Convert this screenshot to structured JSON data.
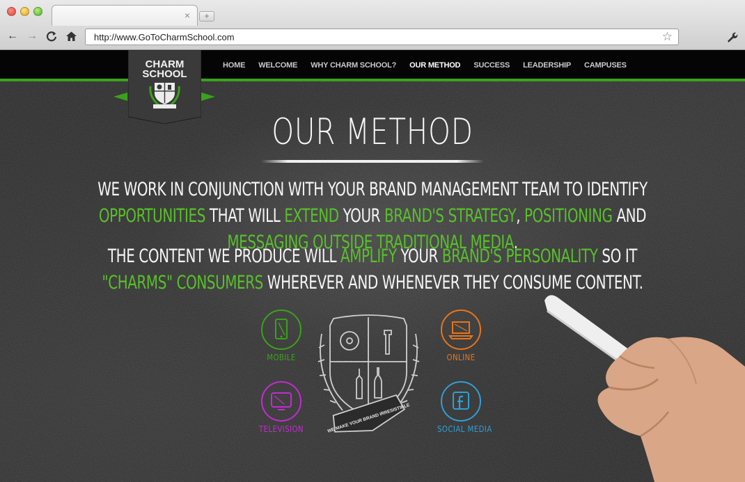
{
  "browser": {
    "tab_close": "×",
    "new_tab": "+",
    "back": "←",
    "forward": "→",
    "reload": "C",
    "home": "⌂",
    "url": "http://www.GoToCharmSchool.com",
    "bookmark": "☆",
    "settings": "🔧"
  },
  "site": {
    "logo_line1": "CHARM",
    "logo_line2": "SCHOOL",
    "nav": [
      "HOME",
      "WELCOME",
      "WHY CHARM SCHOOL?",
      "OUR METHOD",
      "SUCCESS",
      "LEADERSHIP",
      "CAMPUSES"
    ],
    "active_nav": "OUR METHOD",
    "heading": "OUR METHOD",
    "p1": {
      "a": "WE WORK IN CONJUNCTION WITH YOUR BRAND MANAGEMENT TEAM TO IDENTIFY ",
      "b": "OPPORTUNITIES",
      "c": " THAT WILL ",
      "d": "EXTEND",
      "e": " YOUR ",
      "f": "BRAND'S STRATEGY",
      "g": ", ",
      "h": "POSITIONING",
      "i": " AND ",
      "j": "MESSAGING OUTSIDE TRADITIONAL MEDIA",
      "k": "."
    },
    "p2": {
      "a": "THE CONTENT WE PRODUCE WILL ",
      "b": "AMPLIFY",
      "c": " YOUR ",
      "d": "BRAND'S PERSONALITY",
      "e": " SO IT ",
      "f": "\"CHARMS\" CONSUMERS",
      "g": " WHEREVER AND WHENEVER THEY CONSUME CONTENT."
    },
    "crest_banner": "WE MAKE YOUR BRAND IRRESISTIBLE",
    "channels": [
      {
        "label": "MOBILE",
        "color": "#3aa21a",
        "icon": "mobile-phone-icon"
      },
      {
        "label": "ONLINE",
        "color": "#e8751a",
        "icon": "laptop-icon"
      },
      {
        "label": "TELEVISION",
        "color": "#c42bd0",
        "icon": "television-icon"
      },
      {
        "label": "SOCIAL MEDIA",
        "color": "#2f9fd8",
        "icon": "facebook-icon"
      }
    ]
  },
  "colors": {
    "accent_green": "#3aa21a",
    "text_green": "#58c02a",
    "chalkboard": "#2b2b2b"
  }
}
